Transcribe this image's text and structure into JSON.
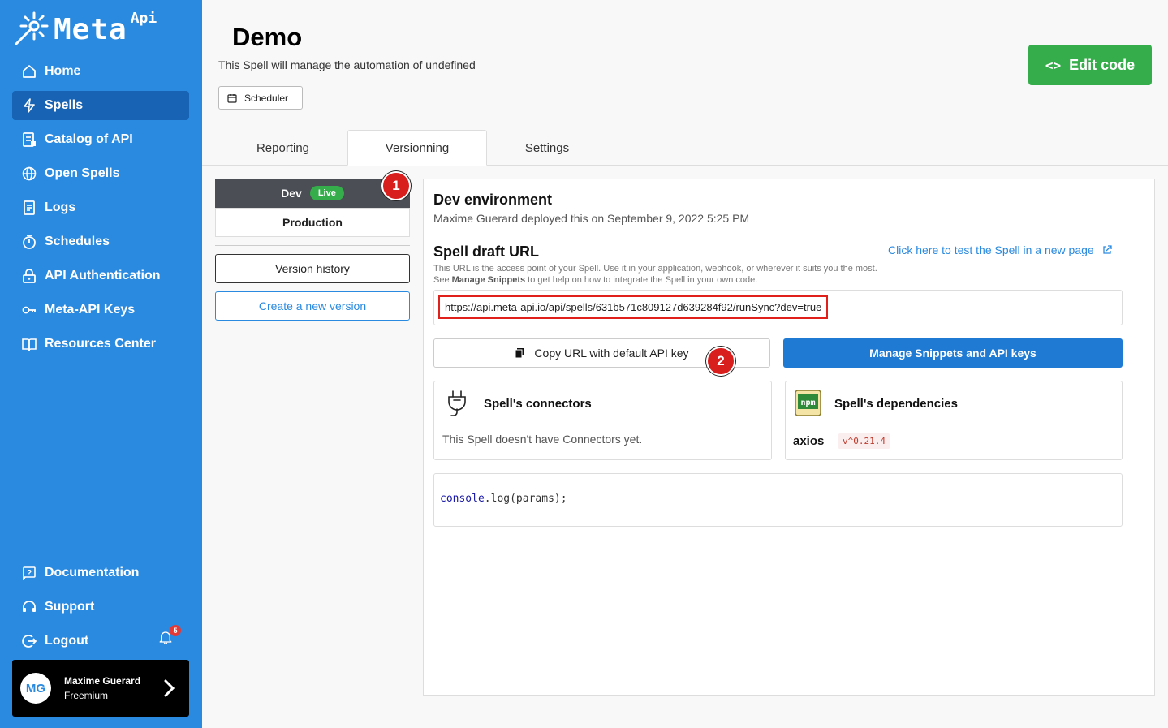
{
  "brand": {
    "name": "Meta",
    "sup": "Api"
  },
  "sidebar": {
    "items": [
      {
        "label": "Home",
        "icon": "home-icon"
      },
      {
        "label": "Spells",
        "icon": "bolt-icon",
        "active": true
      },
      {
        "label": "Catalog of API",
        "icon": "catalog-icon"
      },
      {
        "label": "Open Spells",
        "icon": "globe-icon"
      },
      {
        "label": "Logs",
        "icon": "logs-icon"
      },
      {
        "label": "Schedules",
        "icon": "timer-icon"
      },
      {
        "label": "API Authentication",
        "icon": "lock-icon"
      },
      {
        "label": "Meta-API Keys",
        "icon": "key-icon"
      },
      {
        "label": "Resources Center",
        "icon": "book-icon"
      }
    ],
    "bottom": [
      {
        "label": "Documentation",
        "icon": "help-icon"
      },
      {
        "label": "Support",
        "icon": "headset-icon"
      },
      {
        "label": "Logout",
        "icon": "logout-icon"
      }
    ],
    "notification_count": "5",
    "user": {
      "initials": "MG",
      "name": "Maxime Guerard",
      "plan": "Freemium"
    }
  },
  "header": {
    "title": "Demo",
    "subtitle": "This Spell will manage the automation of undefined",
    "scheduler_label": "Scheduler",
    "edit_code_label": "Edit code"
  },
  "tabs": [
    {
      "label": "Reporting"
    },
    {
      "label": "Versionning",
      "active": true
    },
    {
      "label": "Settings"
    }
  ],
  "environments": {
    "dev_label": "Dev",
    "live_badge": "Live",
    "prod_label": "Production",
    "version_history_label": "Version history",
    "create_version_label": "Create a new version"
  },
  "markers": {
    "one": "1",
    "two": "2"
  },
  "detail": {
    "env_title": "Dev environment",
    "deploy_info": "Maxime Guerard deployed this on September 9, 2022 5:25 PM",
    "draft_title": "Spell draft URL",
    "test_link": "Click here to test the Spell in a new page",
    "desc_line1": "This URL is the access point of your Spell. Use it in your application, webhook, or wherever it suits you the most.",
    "desc_line2_pre": "See ",
    "desc_line2_bold": "Manage Snippets",
    "desc_line2_post": " to get help on how to integrate the Spell in your own code.",
    "url": "https://api.meta-api.io/api/spells/631b571c809127d639284f92/runSync?dev=true",
    "copy_label": "Copy URL with default API key",
    "manage_label": "Manage Snippets and API keys",
    "connectors_title": "Spell's connectors",
    "connectors_empty": "This Spell doesn't have Connectors yet.",
    "deps_title": "Spell's dependencies",
    "deps": [
      {
        "name": "axios",
        "version": "v^0.21.4"
      }
    ],
    "code_obj": "console",
    "code_rest": ".log(params);"
  },
  "colors": {
    "sidebar": "#2a8ae0",
    "active_nav": "#1863b3",
    "success": "#34ad4a",
    "marker": "#d91e1e",
    "highlight": "#e0201a"
  }
}
